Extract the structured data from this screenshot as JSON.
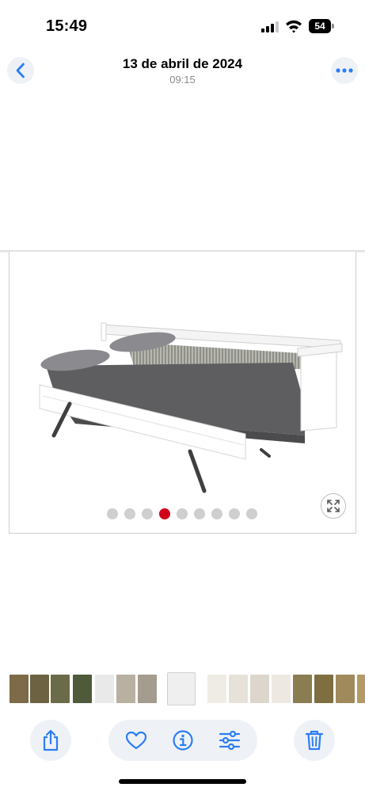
{
  "status_bar": {
    "time": "15:49",
    "battery_level": "54",
    "icons": [
      "signal-icon",
      "wifi-icon",
      "battery-icon"
    ]
  },
  "header": {
    "title": "13 de abril de 2024",
    "subtitle": "09:15",
    "back_icon": "chevron-left-icon",
    "more_icon": "more-icon"
  },
  "photo": {
    "carousel": {
      "dot_count": 9,
      "active_index": 3,
      "active_color": "#d0021b",
      "inactive_color": "#cfcfcf"
    },
    "expand_icon": "expand-icon"
  },
  "thumbnails": {
    "count": 18,
    "current_index": 7
  },
  "toolbar": {
    "left": "share-icon",
    "group": [
      "heart-icon",
      "info-icon",
      "adjust-icon"
    ],
    "right": "trash-icon"
  },
  "colors": {
    "accent": "#2c7df6",
    "button_bg": "#eef2f7"
  }
}
